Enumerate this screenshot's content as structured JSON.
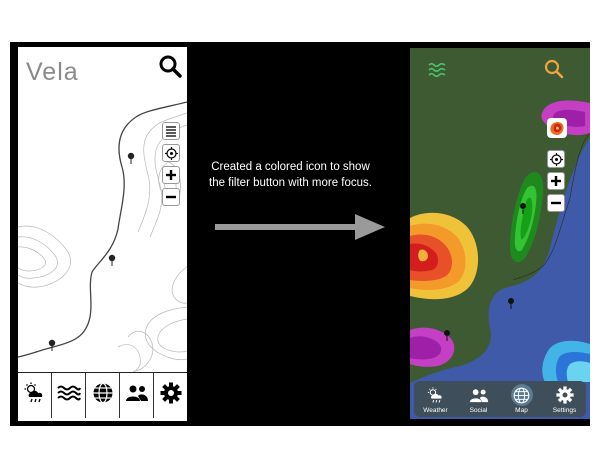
{
  "left_screen": {
    "app_title": "Vela",
    "icons": {
      "search": "search-icon",
      "filter": "filter-list-icon",
      "locate": "locate-icon",
      "zoom_in": "plus-icon",
      "zoom_out": "minus-icon"
    },
    "tabs": [
      {
        "icon": "weather-icon"
      },
      {
        "icon": "waves-icon"
      },
      {
        "icon": "globe-icon"
      },
      {
        "icon": "people-icon"
      },
      {
        "icon": "gear-icon"
      }
    ]
  },
  "caption": {
    "text": "Created a colored icon to show the filter button with more focus."
  },
  "right_screen": {
    "icons": {
      "waves": "waves-icon",
      "search": "search-icon",
      "filter": "colored-filter-icon",
      "locate": "locate-icon",
      "zoom_in": "plus-icon",
      "zoom_out": "minus-icon"
    },
    "tabs": [
      {
        "label": "Weather",
        "icon": "weather-icon"
      },
      {
        "label": "Social",
        "icon": "people-icon"
      },
      {
        "label": "Map",
        "icon": "globe-icon",
        "active": true
      },
      {
        "label": "Settings",
        "icon": "gear-icon"
      }
    ]
  },
  "colors": {
    "land": "#3d5a32",
    "water": "#3f5aa8",
    "accent_search": "#f2a341",
    "tabbar": "#3e4e5a"
  }
}
